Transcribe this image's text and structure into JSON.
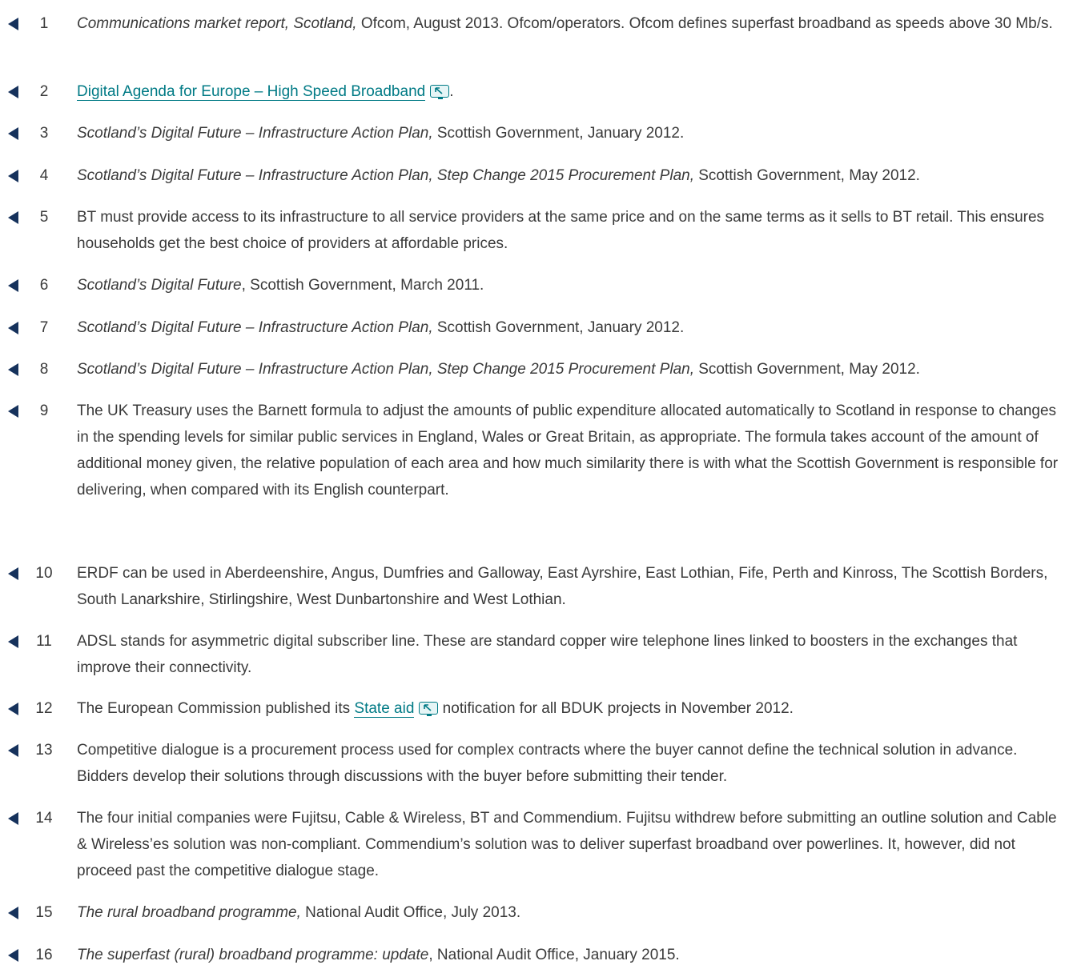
{
  "colors": {
    "arrow": "#16325c",
    "link": "#007a85",
    "text": "#3a3a3a"
  },
  "notes": [
    {
      "num": "1",
      "parts": [
        {
          "t": "Communications market report, Scotland,",
          "i": true
        },
        {
          "t": " Ofcom, August 2013. Ofcom/operators. Ofcom defines superfast broadband as speeds above 30 Mb/s."
        }
      ]
    },
    {
      "num": "2",
      "parts": [
        {
          "t": "Digital Agenda for Europe – High Speed Broadband",
          "link": true
        },
        {
          "t": "."
        }
      ]
    },
    {
      "num": "3",
      "parts": [
        {
          "t": "Scotland’s Digital Future – Infrastructure Action Plan,",
          "i": true
        },
        {
          "t": " Scottish Government, January 2012."
        }
      ]
    },
    {
      "num": "4",
      "parts": [
        {
          "t": "Scotland’s Digital Future – Infrastructure Action Plan, Step Change 2015 Procurement Plan,",
          "i": true
        },
        {
          "t": " Scottish Government, May 2012."
        }
      ]
    },
    {
      "num": "5",
      "parts": [
        {
          "t": "BT must provide access to its infrastructure to all service providers at the same price and on the same terms as it sells to BT retail. This ensures households get the best choice of providers at affordable prices."
        }
      ]
    },
    {
      "num": "6",
      "parts": [
        {
          "t": "Scotland’s Digital Future",
          "i": true
        },
        {
          "t": ", Scottish Government, March 2011."
        }
      ]
    },
    {
      "num": "7",
      "parts": [
        {
          "t": "Scotland’s Digital Future – Infrastructure Action Plan,",
          "i": true
        },
        {
          "t": " Scottish Government, January 2012."
        }
      ]
    },
    {
      "num": "8",
      "parts": [
        {
          "t": "Scotland’s Digital Future – Infrastructure Action Plan, Step Change 2015 Procurement Plan,",
          "i": true
        },
        {
          "t": " Scottish Government, May 2012."
        }
      ]
    },
    {
      "num": "9",
      "parts": [
        {
          "t": "The UK Treasury uses the Barnett formula to adjust the amounts of public expenditure allocated automatically to Scotland in response to changes in the spending levels for similar public services in England, Wales or Great Britain, as appropriate. The formula takes account of the amount of additional money given, the relative population of each area and how much similarity there is with what the Scottish Government is responsible for delivering, when compared with its English counterpart."
        }
      ]
    },
    {
      "num": "10",
      "parts": [
        {
          "t": "ERDF can be used in Aberdeenshire, Angus, Dumfries and Galloway, East Ayrshire, East Lothian, Fife, Perth and Kinross, The Scottish Borders, South Lanarkshire, Stirlingshire, West Dunbartonshire and West Lothian."
        }
      ]
    },
    {
      "num": "11",
      "parts": [
        {
          "t": "ADSL stands for asymmetric digital subscriber line. These are standard copper wire telephone lines linked to boosters in the exchanges that improve their connectivity."
        }
      ]
    },
    {
      "num": "12",
      "parts": [
        {
          "t": "The European Commission published its "
        },
        {
          "t": "State aid",
          "link": true
        },
        {
          "t": " notification for all BDUK projects in November 2012."
        }
      ]
    },
    {
      "num": "13",
      "parts": [
        {
          "t": "Competitive dialogue is a procurement process used for complex contracts where the buyer cannot define the technical solution in advance. Bidders develop their solutions through discussions with the buyer before submitting their tender."
        }
      ]
    },
    {
      "num": "14",
      "parts": [
        {
          "t": "The four initial companies were Fujitsu, Cable & Wireless, BT and Commendium. Fujitsu withdrew before submitting an outline solution and Cable & Wireless’es solution was non-compliant. Commendium’s solution was to deliver superfast broadband over powerlines. It, however, did not proceed past the competitive dialogue stage."
        }
      ]
    },
    {
      "num": "15",
      "parts": [
        {
          "t": "The rural broadband programme,",
          "i": true
        },
        {
          "t": " National Audit Office, July 2013."
        }
      ]
    },
    {
      "num": "16",
      "parts": [
        {
          "t": "The superfast (rural) broadband programme: update",
          "i": true
        },
        {
          "t": ", National Audit Office, January 2015."
        }
      ]
    }
  ]
}
